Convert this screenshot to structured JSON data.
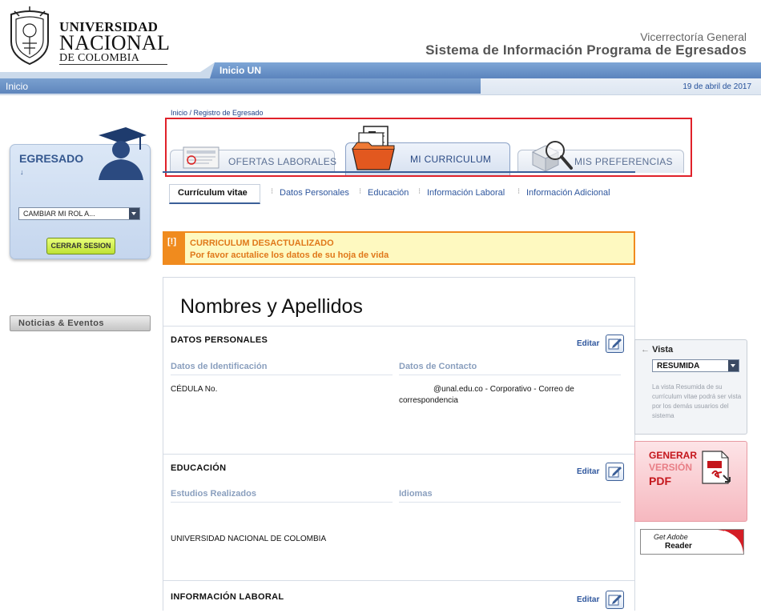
{
  "header": {
    "logo": {
      "line1": "UNIVERSIDAD",
      "line2": "NACIONAL",
      "line3": "DE COLOMBIA"
    },
    "vicerrectoria": "Vicerrectoría General",
    "system_name": "Sistema de Información Programa de Egresados",
    "inicio_un": "Inicio UN",
    "nav_inicio": "Inicio",
    "date": "19 de abril de 2017"
  },
  "breadcrumb": "Inicio / Registro de Egresado",
  "tabs": [
    {
      "label": "OFERTAS LABORALES"
    },
    {
      "label": "MI CURRICULUM"
    },
    {
      "label": "MIS PREFERENCIAS"
    }
  ],
  "subtabs": [
    {
      "label": "Currículum vitae"
    },
    {
      "label": "Datos Personales"
    },
    {
      "label": "Educación"
    },
    {
      "label": "Información Laboral"
    },
    {
      "label": "Información Adicional"
    }
  ],
  "warning": {
    "icon": "[!]",
    "title": "CURRICULUM DESACTUALIZADO",
    "message": "Por favor acutalice los datos de su hoja de vida"
  },
  "sidebar": {
    "role_title": "EGRESADO",
    "role_arrow": "↓",
    "role_select": "CAMBIAR MI ROL A...",
    "logout": "CERRAR SESION",
    "news": "Noticias & Eventos"
  },
  "cv": {
    "name": "Nombres y Apellidos",
    "edit_label": "Editar",
    "datos_personales": {
      "title": "DATOS PERSONALES",
      "identificacion_head": "Datos de Identificación",
      "contacto_head": "Datos de Contacto",
      "cedula": "CÉDULA No.",
      "email_line1": "@unal.edu.co - Corporativo - Correo de",
      "email_line2": "correspondencia"
    },
    "educacion": {
      "title": "EDUCACIÓN",
      "estudios_head": "Estudios Realizados",
      "idiomas_head": "Idiomas",
      "institucion": "UNIVERSIDAD NACIONAL DE COLOMBIA"
    },
    "informacion_laboral": {
      "title": "INFORMACIÓN LABORAL"
    }
  },
  "right_sidebar": {
    "vista_title": "Vista",
    "vista_arrow": "←",
    "vista_value": "RESUMIDA",
    "vista_note": "La vista Resumida de su currículum vitae podrá ser vista por los demás usuarios del sistema",
    "pdf_line1": "GENERAR",
    "pdf_line2": "VERSIÓN",
    "pdf_line3": "PDF",
    "adobe_line1": "Get Adobe",
    "adobe_line2": "Reader"
  },
  "colors": {
    "brand_blue": "#3b5f98",
    "link_blue": "#2e569d",
    "warning_orange": "#f08b1e",
    "highlight_red": "#e0212a",
    "pdf_red": "#c4161c"
  }
}
